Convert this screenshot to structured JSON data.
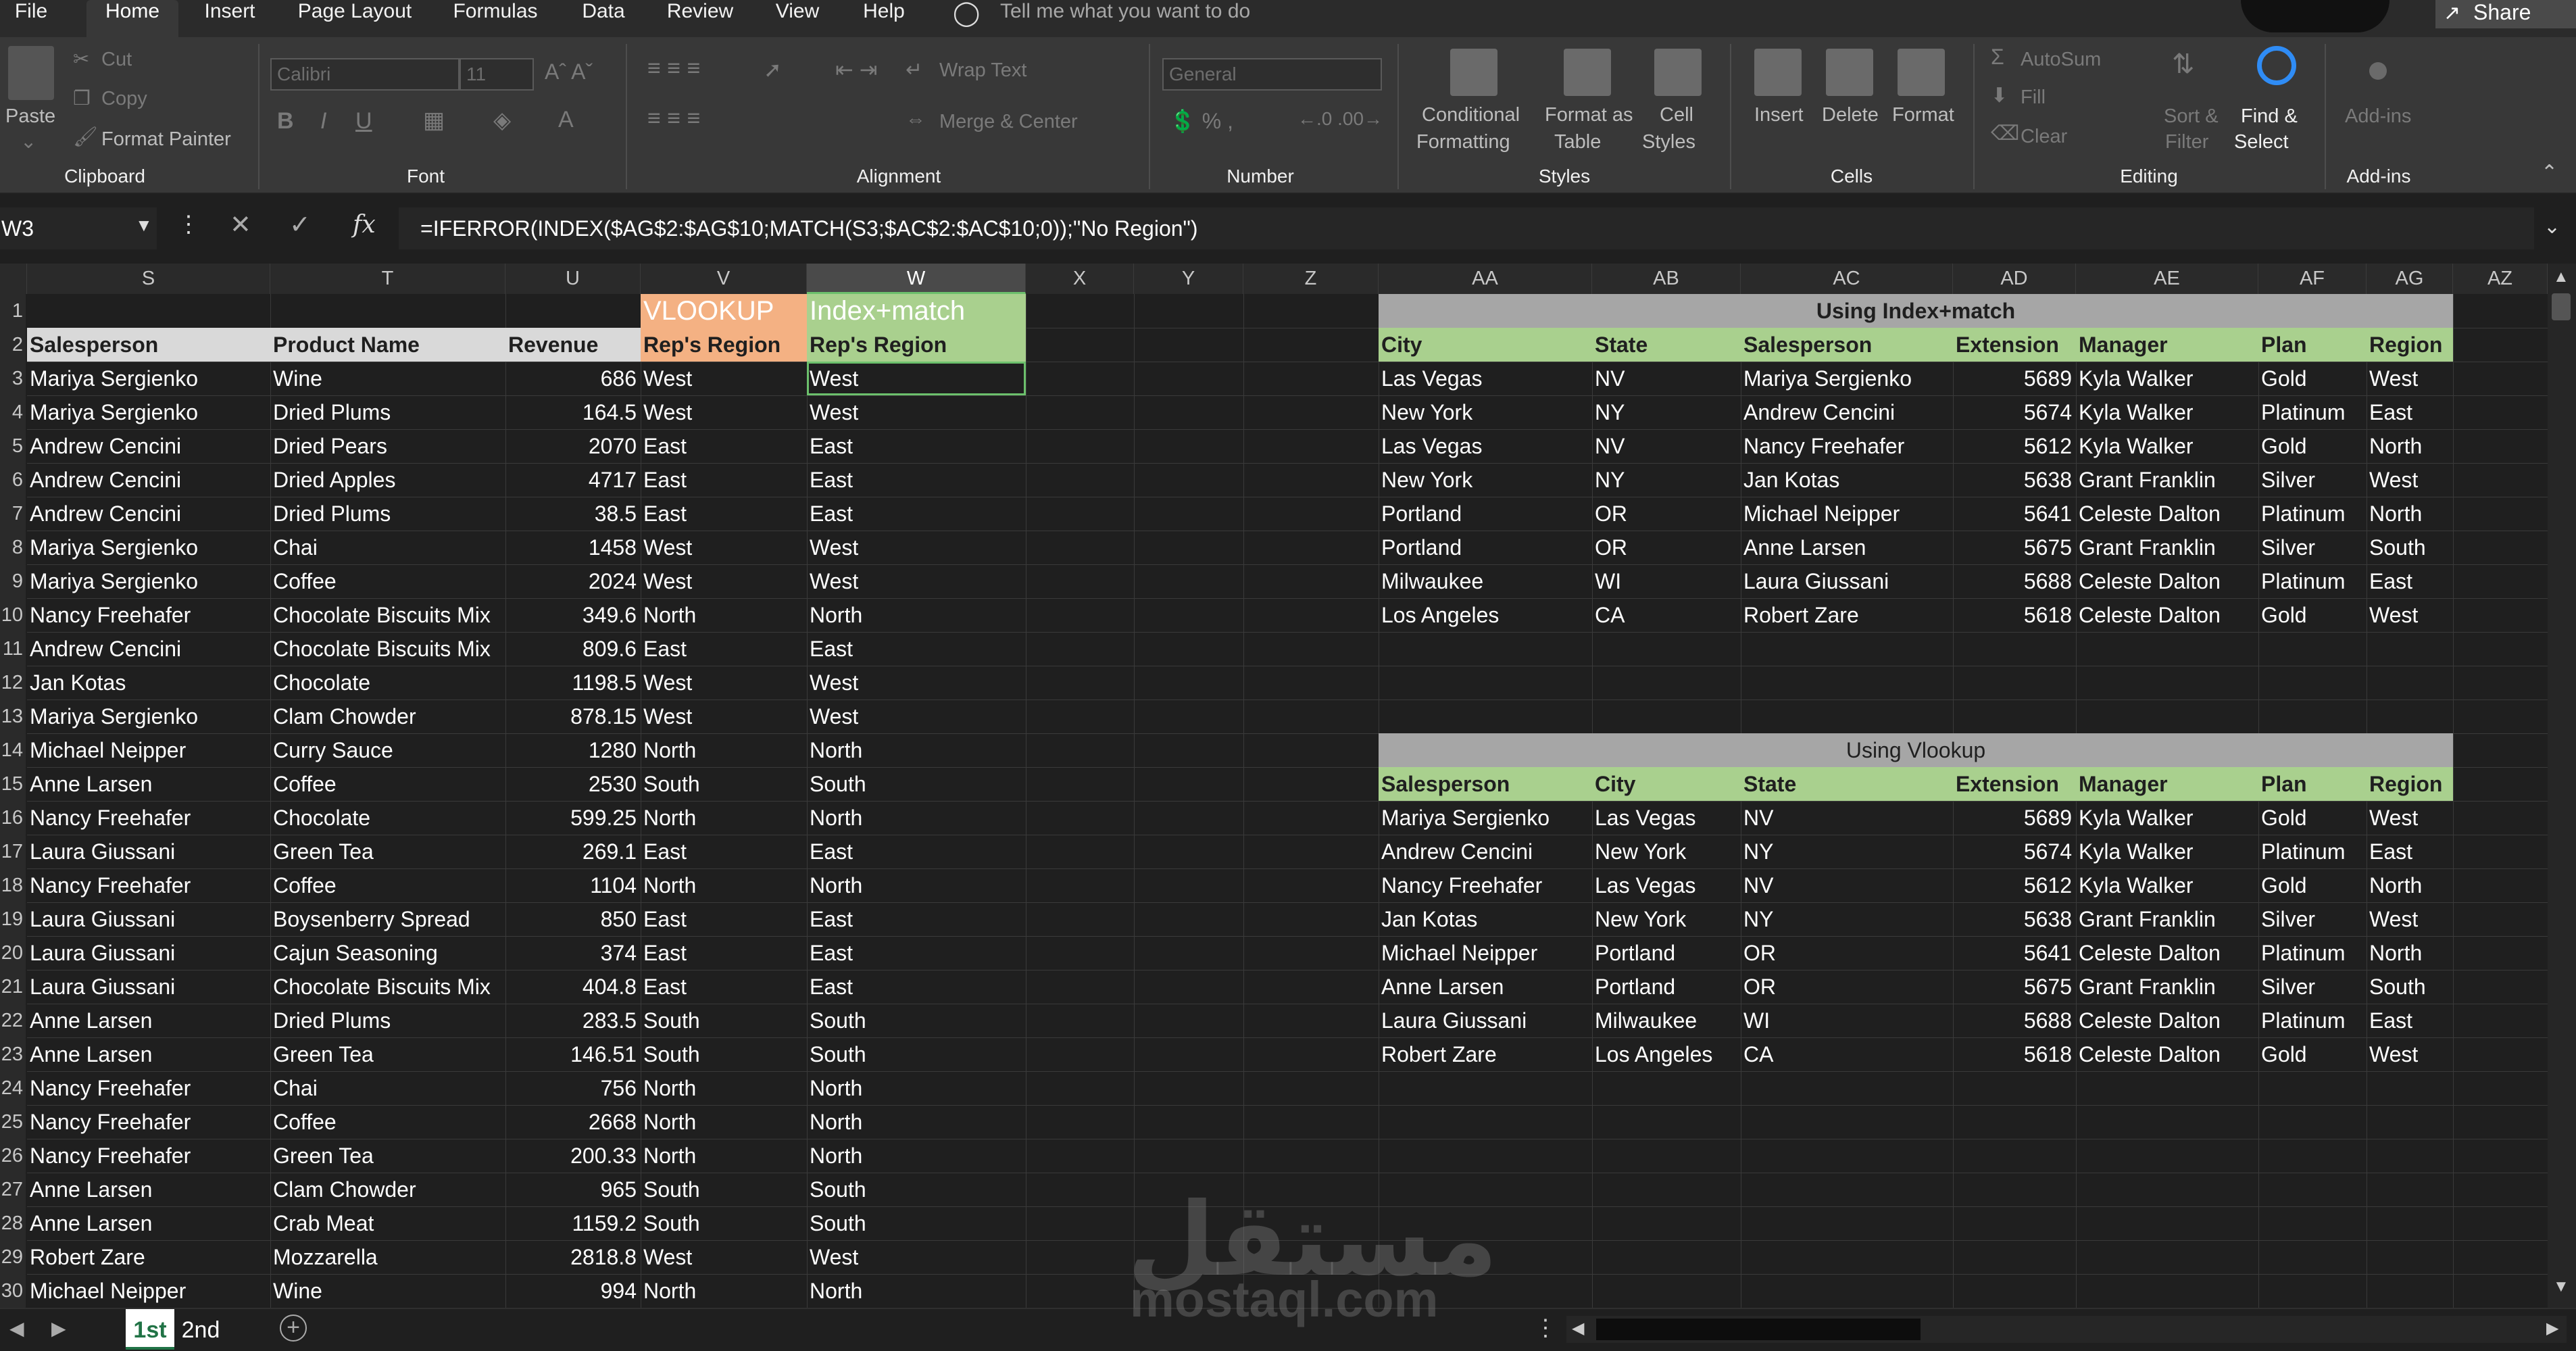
{
  "tabs": [
    "File",
    "Home",
    "Insert",
    "Page Layout",
    "Formulas",
    "Data",
    "Review",
    "View",
    "Help"
  ],
  "tell_me": "Tell me what you want to do",
  "share": "Share",
  "ribbon": {
    "clipboard": {
      "paste": "Paste",
      "cut": "Cut",
      "copy": "Copy",
      "format_painter": "Format Painter",
      "group": "Clipboard"
    },
    "font": {
      "name": "Calibri",
      "size": "11",
      "group": "Font"
    },
    "alignment": {
      "wrap": "Wrap Text",
      "merge": "Merge & Center",
      "group": "Alignment"
    },
    "number": {
      "format": "General",
      "group": "Number"
    },
    "styles": {
      "conditional": [
        "Conditional",
        "Formatting"
      ],
      "format_table": [
        "Format as",
        "Table"
      ],
      "cell_styles": [
        "Cell",
        "Styles"
      ],
      "group": "Styles"
    },
    "cells": {
      "insert": "Insert",
      "delete": "Delete",
      "format": "Format",
      "group": "Cells"
    },
    "editing": {
      "autosum": "AutoSum",
      "fill": "Fill",
      "clear": "Clear",
      "sort": [
        "Sort &",
        "Filter"
      ],
      "find": [
        "Find &",
        "Select"
      ],
      "group": "Editing"
    },
    "addins": {
      "label": "Add-ins",
      "group": "Add-ins"
    }
  },
  "name_box": "W3",
  "formula": "=IFERROR(INDEX($AG$2:$AG$10;MATCH(S3;$AC$2:$AC$10;0));\"No Region\")",
  "columns": [
    "S",
    "T",
    "U",
    "V",
    "W",
    "X",
    "Y",
    "Z",
    "AA",
    "AB",
    "AC",
    "AD",
    "AE",
    "AF",
    "AG",
    "AZ"
  ],
  "rows": [
    "1",
    "2",
    "3",
    "4",
    "5",
    "6",
    "7",
    "8",
    "9",
    "10",
    "11",
    "12",
    "13",
    "14",
    "15",
    "16",
    "17",
    "18",
    "19",
    "20",
    "21",
    "22",
    "23",
    "24",
    "25",
    "26",
    "27",
    "28",
    "29",
    "30"
  ],
  "left": {
    "vlookup_title": "VLOOKUP",
    "index_title": "Index+match",
    "headers": [
      "Salesperson",
      "Product Name",
      "Revenue",
      "Rep's Region",
      "Rep's Region"
    ],
    "data": [
      [
        "Mariya Sergienko",
        "Wine",
        "686",
        "West",
        "West"
      ],
      [
        "Mariya Sergienko",
        "Dried Plums",
        "164.5",
        "West",
        "West"
      ],
      [
        "Andrew Cencini",
        "Dried Pears",
        "2070",
        "East",
        "East"
      ],
      [
        "Andrew Cencini",
        "Dried Apples",
        "4717",
        "East",
        "East"
      ],
      [
        "Andrew Cencini",
        "Dried Plums",
        "38.5",
        "East",
        "East"
      ],
      [
        "Mariya Sergienko",
        "Chai",
        "1458",
        "West",
        "West"
      ],
      [
        "Mariya Sergienko",
        "Coffee",
        "2024",
        "West",
        "West"
      ],
      [
        "Nancy Freehafer",
        "Chocolate Biscuits Mix",
        "349.6",
        "North",
        "North"
      ],
      [
        "Andrew Cencini",
        "Chocolate Biscuits Mix",
        "809.6",
        "East",
        "East"
      ],
      [
        "Jan Kotas",
        "Chocolate",
        "1198.5",
        "West",
        "West"
      ],
      [
        "Mariya Sergienko",
        "Clam Chowder",
        "878.15",
        "West",
        "West"
      ],
      [
        "Michael Neipper",
        "Curry Sauce",
        "1280",
        "North",
        "North"
      ],
      [
        "Anne Larsen",
        "Coffee",
        "2530",
        "South",
        "South"
      ],
      [
        "Nancy Freehafer",
        "Chocolate",
        "599.25",
        "North",
        "North"
      ],
      [
        "Laura Giussani",
        "Green Tea",
        "269.1",
        "East",
        "East"
      ],
      [
        "Nancy Freehafer",
        "Coffee",
        "1104",
        "North",
        "North"
      ],
      [
        "Laura Giussani",
        "Boysenberry Spread",
        "850",
        "East",
        "East"
      ],
      [
        "Laura Giussani",
        "Cajun Seasoning",
        "374",
        "East",
        "East"
      ],
      [
        "Laura Giussani",
        "Chocolate Biscuits Mix",
        "404.8",
        "East",
        "East"
      ],
      [
        "Anne Larsen",
        "Dried Plums",
        "283.5",
        "South",
        "South"
      ],
      [
        "Anne Larsen",
        "Green Tea",
        "146.51",
        "South",
        "South"
      ],
      [
        "Nancy Freehafer",
        "Chai",
        "756",
        "North",
        "North"
      ],
      [
        "Nancy Freehafer",
        "Coffee",
        "2668",
        "North",
        "North"
      ],
      [
        "Nancy Freehafer",
        "Green Tea",
        "200.33",
        "North",
        "North"
      ],
      [
        "Anne Larsen",
        "Clam Chowder",
        "965",
        "South",
        "South"
      ],
      [
        "Anne Larsen",
        "Crab Meat",
        "1159.2",
        "South",
        "South"
      ],
      [
        "Robert Zare",
        "Mozzarella",
        "2818.8",
        "West",
        "West"
      ],
      [
        "Michael Neipper",
        "Wine",
        "994",
        "North",
        "North"
      ]
    ]
  },
  "index_table": {
    "title": "Using Index+match",
    "headers": [
      "City",
      "State",
      "Salesperson",
      "Extension",
      "Manager",
      "Plan",
      "Region"
    ],
    "data": [
      [
        "Las Vegas",
        "NV",
        "Mariya Sergienko",
        "5689",
        "Kyla Walker",
        "Gold",
        "West"
      ],
      [
        "New York",
        "NY",
        "Andrew Cencini",
        "5674",
        "Kyla Walker",
        "Platinum",
        "East"
      ],
      [
        "Las Vegas",
        "NV",
        "Nancy Freehafer",
        "5612",
        "Kyla Walker",
        "Gold",
        "North"
      ],
      [
        "New York",
        "NY",
        "Jan Kotas",
        "5638",
        "Grant Franklin",
        "Silver",
        "West"
      ],
      [
        "Portland",
        "OR",
        "Michael Neipper",
        "5641",
        "Celeste Dalton",
        "Platinum",
        "North"
      ],
      [
        "Portland",
        "OR",
        "Anne Larsen",
        "5675",
        "Grant Franklin",
        "Silver",
        "South"
      ],
      [
        "Milwaukee",
        "WI",
        "Laura Giussani",
        "5688",
        "Celeste Dalton",
        "Platinum",
        "East"
      ],
      [
        "Los Angeles",
        "CA",
        "Robert Zare",
        "5618",
        "Celeste Dalton",
        "Gold",
        "West"
      ]
    ]
  },
  "vlookup_table": {
    "title": "Using Vlookup",
    "headers": [
      "Salesperson",
      "City",
      "State",
      "Extension",
      "Manager",
      "Plan",
      "Region"
    ],
    "data": [
      [
        "Mariya Sergienko",
        "Las Vegas",
        "NV",
        "5689",
        "Kyla Walker",
        "Gold",
        "West"
      ],
      [
        "Andrew Cencini",
        "New York",
        "NY",
        "5674",
        "Kyla Walker",
        "Platinum",
        "East"
      ],
      [
        "Nancy Freehafer",
        "Las Vegas",
        "NV",
        "5612",
        "Kyla Walker",
        "Gold",
        "North"
      ],
      [
        "Jan Kotas",
        "New York",
        "NY",
        "5638",
        "Grant Franklin",
        "Silver",
        "West"
      ],
      [
        "Michael Neipper",
        "Portland",
        "OR",
        "5641",
        "Celeste Dalton",
        "Platinum",
        "North"
      ],
      [
        "Anne Larsen",
        "Portland",
        "OR",
        "5675",
        "Grant Franklin",
        "Silver",
        "South"
      ],
      [
        "Laura Giussani",
        "Milwaukee",
        "WI",
        "5688",
        "Celeste Dalton",
        "Platinum",
        "East"
      ],
      [
        "Robert Zare",
        "Los Angeles",
        "CA",
        "5618",
        "Celeste Dalton",
        "Gold",
        "West"
      ]
    ]
  },
  "sheets": [
    "1st",
    "2nd"
  ],
  "watermark": [
    "مستقل",
    "mostaql.com"
  ],
  "colors": {
    "orange": "#f4b183",
    "green": "#a9d08e",
    "gray": "#a6a6a6",
    "accent": "#217346"
  }
}
